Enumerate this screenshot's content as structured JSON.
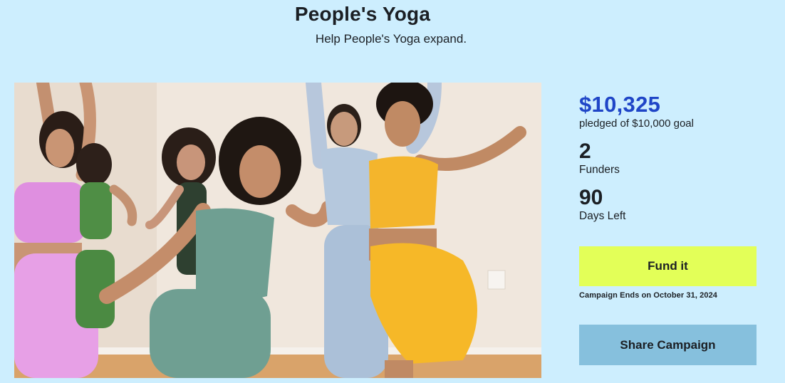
{
  "campaign": {
    "title": "People's Yoga",
    "subtitle": "Help People's Yoga expand."
  },
  "stats": {
    "pledged_amount": "$10,325",
    "pledged_label": "pledged of $10,000 goal",
    "funders_count": "2",
    "funders_label": "Funders",
    "days_left": "90",
    "days_left_label": "Days Left"
  },
  "actions": {
    "fund_label": "Fund it",
    "campaign_end_text": "Campaign Ends on October 31, 2024",
    "share_label": "Share Campaign"
  },
  "colors": {
    "page_background": "#cdeefe",
    "pledged_amount": "#1f45c7",
    "fund_button": "#e3ff58",
    "share_button": "#86c0dd"
  }
}
